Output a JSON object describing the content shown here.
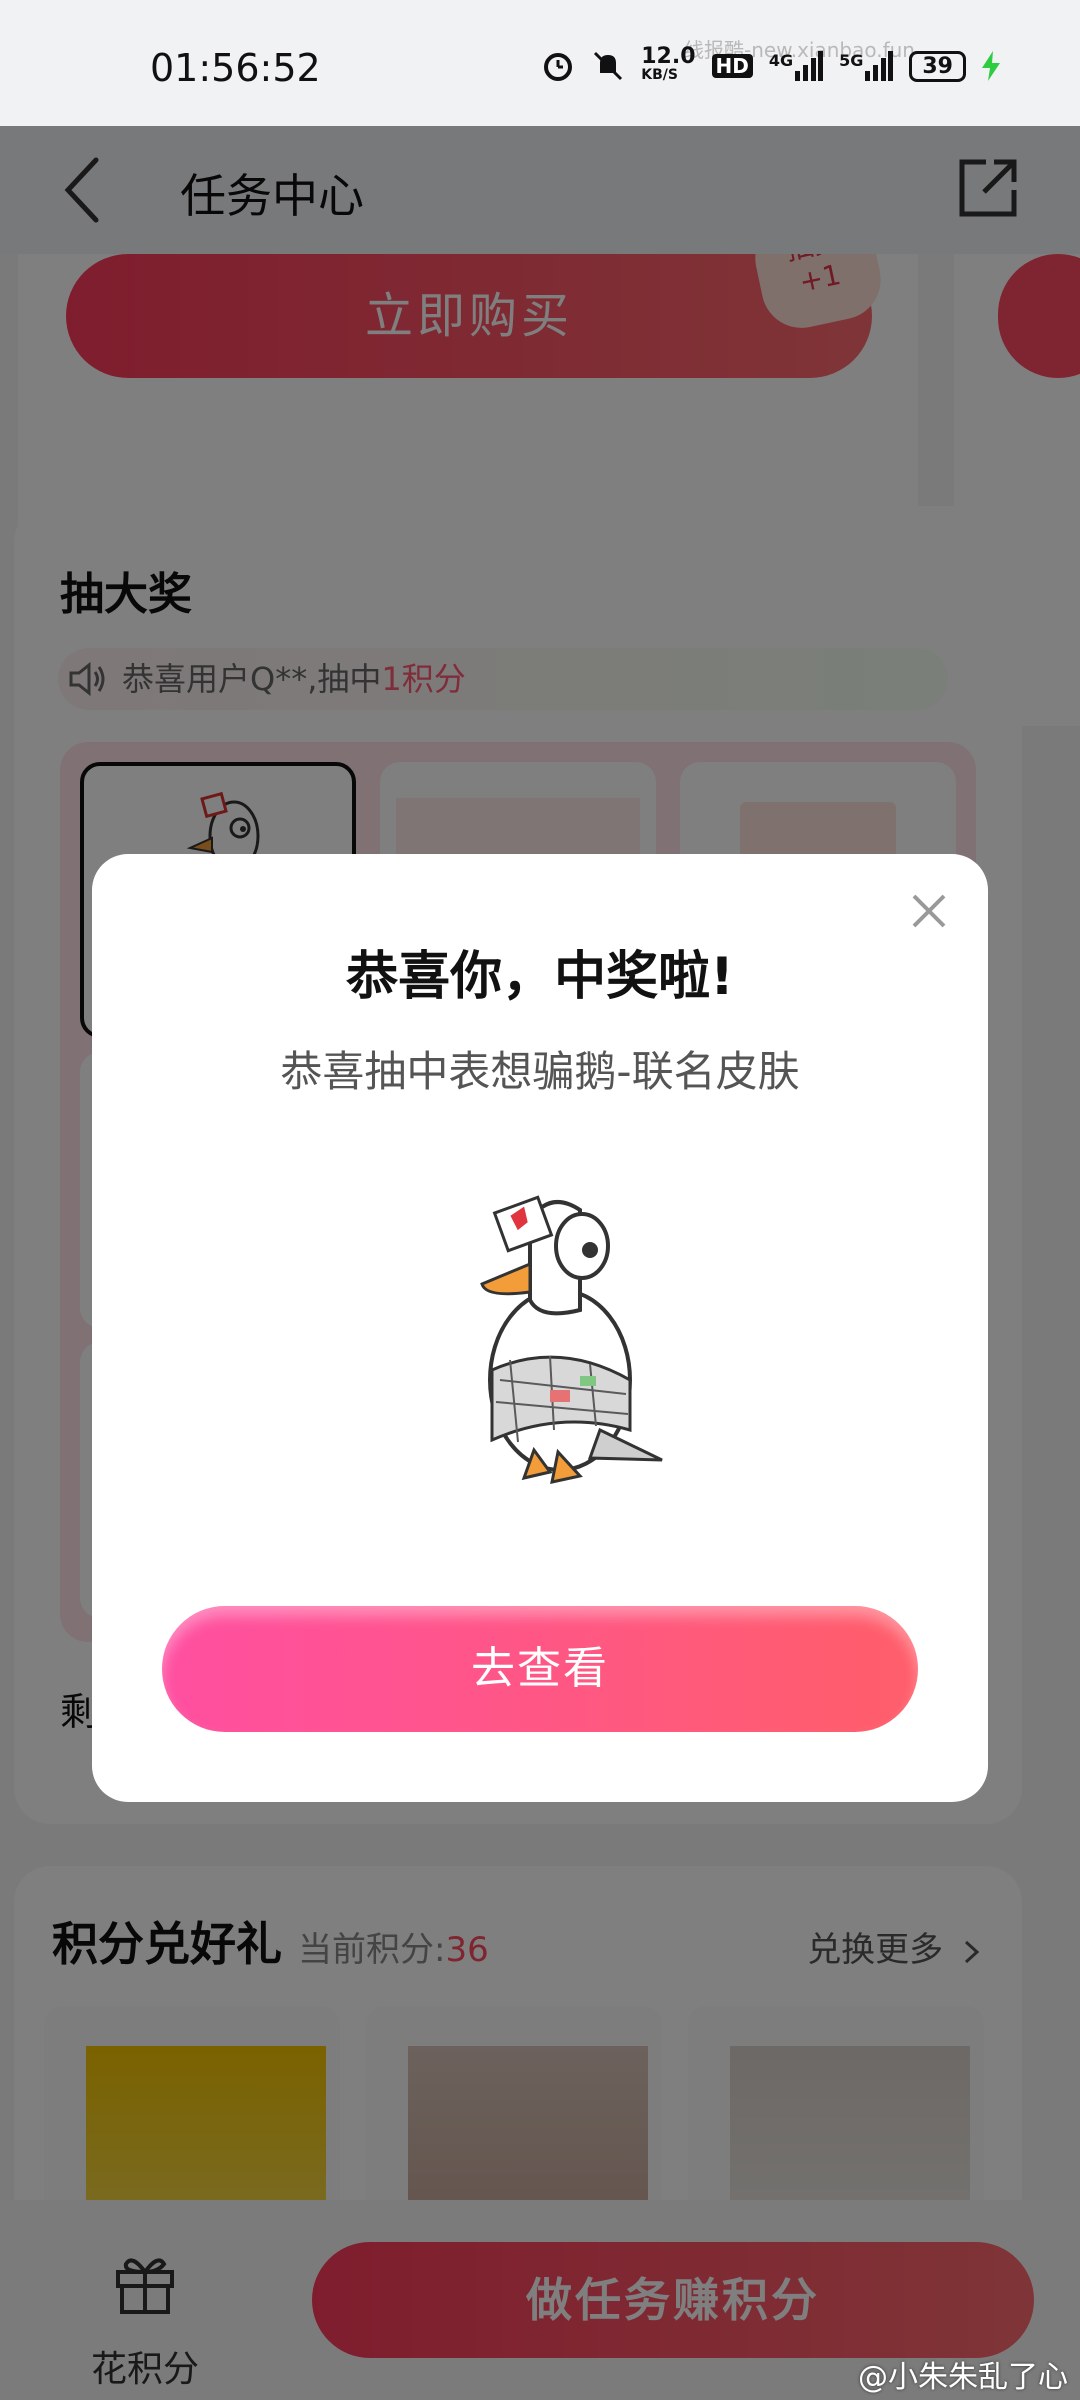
{
  "status_bar": {
    "time": "01:56:52",
    "net_speed": "12.0",
    "net_speed_unit": "KB/S",
    "hd": "HD",
    "sig1": "4G",
    "sig2": "5G",
    "battery": "39",
    "watermark": "线报酷-new.xianbao.fun"
  },
  "nav": {
    "title": "任务中心"
  },
  "buy_card": {
    "button_label": "立即购买",
    "badge_line1": "抽奖",
    "badge_line2": "+1"
  },
  "draw": {
    "title": "抽大奖",
    "notice_prefix": "恭喜用户Q**,抽中",
    "notice_highlight": "1积分",
    "remaining_label": "剩"
  },
  "exchange": {
    "title": "积分兑好礼",
    "points_label": "当前积分:",
    "points_value": "36",
    "more_label": "兑换更多"
  },
  "modal": {
    "title": "恭喜你，中奖啦!",
    "subtitle": "恭喜抽中表想骗鹅-联名皮肤",
    "button_label": "去查看"
  },
  "bottom_bar": {
    "spend_label": "花积分",
    "task_button_label": "做任务赚积分"
  },
  "weibo_watermark": "@小朱朱乱了心",
  "colors": {
    "accent": "#ff4a64",
    "modal_button_start": "#ff4fa1",
    "modal_button_end": "#ff5e6a",
    "points_value": "#ff4a5e"
  }
}
